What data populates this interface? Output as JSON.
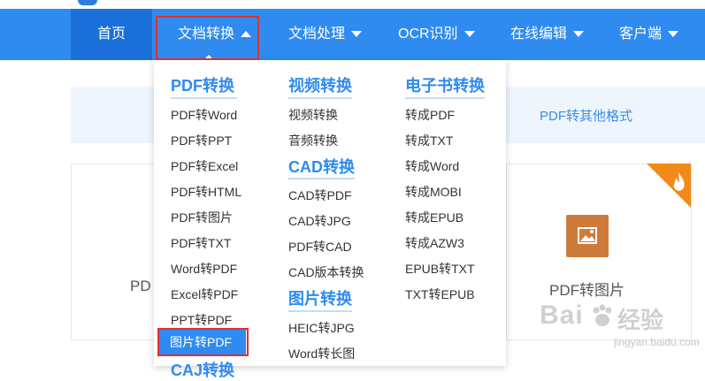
{
  "nav": {
    "items": [
      {
        "label": "首页"
      },
      {
        "label": "文档转换"
      },
      {
        "label": "文档处理"
      },
      {
        "label": "OCR识别"
      },
      {
        "label": "在线编辑"
      },
      {
        "label": "客户端"
      }
    ]
  },
  "format_bar": {
    "label": "PDF转其他格式"
  },
  "cards": {
    "left_partial": "PD",
    "right": "PDF转图片"
  },
  "dropdown": {
    "col1": {
      "heading": "PDF转换",
      "links": [
        "PDF转Word",
        "PDF转PPT",
        "PDF转Excel",
        "PDF转HTML",
        "PDF转图片",
        "PDF转TXT",
        "Word转PDF",
        "Excel转PDF",
        "PPT转PDF",
        "图片转PDF"
      ],
      "next_heading_partial": "CAJ转换"
    },
    "col2": {
      "heading1": "视频转换",
      "links1": [
        "视频转换",
        "音频转换"
      ],
      "heading2": "CAD转换",
      "links2": [
        "CAD转PDF",
        "CAD转JPG",
        "PDF转CAD",
        "CAD版本转换"
      ],
      "heading3": "图片转换",
      "links3": [
        "HEIC转JPG",
        "Word转长图"
      ]
    },
    "col3": {
      "heading": "电子书转换",
      "links": [
        "转成PDF",
        "转成TXT",
        "转成Word",
        "转成MOBI",
        "转成EPUB",
        "转成AZW3",
        "EPUB转TXT",
        "TXT转EPUB"
      ]
    }
  },
  "watermark": {
    "brand": "Bai",
    "brand2": "经验",
    "url": "jingyan.baidu.com"
  },
  "colors": {
    "nav_bg": "#2f8bf0",
    "nav_active": "#1a6fd8",
    "accent": "#2f8bf0",
    "highlight": "#e0302f"
  }
}
